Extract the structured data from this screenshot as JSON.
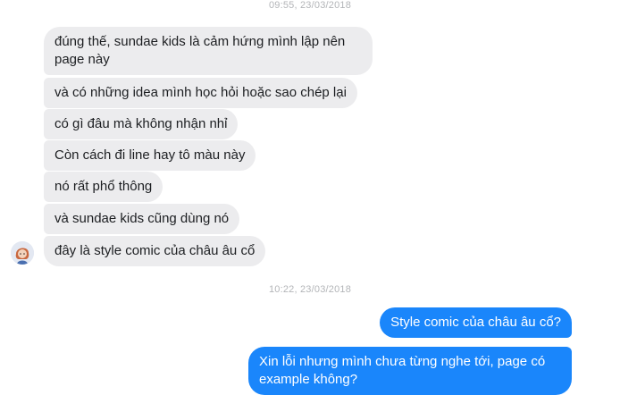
{
  "conversation": {
    "timestamps": {
      "first": "09:55, 23/03/2018",
      "second": "10:22, 23/03/2018"
    },
    "incoming": [
      {
        "text": "đúng thế, sundae kids là cảm hứng mình lập nên page này"
      },
      {
        "text": "và có những idea mình học hỏi hoặc sao chép lại"
      },
      {
        "text": "có gì đâu mà không nhận nhỉ"
      },
      {
        "text": "Còn cách đi line hay tô màu này"
      },
      {
        "text": "nó rất phổ thông"
      },
      {
        "text": "và sundae kids cũng dùng nó"
      },
      {
        "text": "đây là style comic của châu âu cổ"
      }
    ],
    "outgoing": [
      {
        "text": "Style comic của châu âu cổ?"
      },
      {
        "text": "Xin lỗi nhưng mình chưa từng nghe tới, page có example không?"
      }
    ],
    "colors": {
      "incoming_bubble": "#ececee",
      "outgoing_bubble": "#1a86fb",
      "timestamp_text": "#b3b5b8"
    },
    "avatar_icon": "sender-avatar-icon"
  }
}
